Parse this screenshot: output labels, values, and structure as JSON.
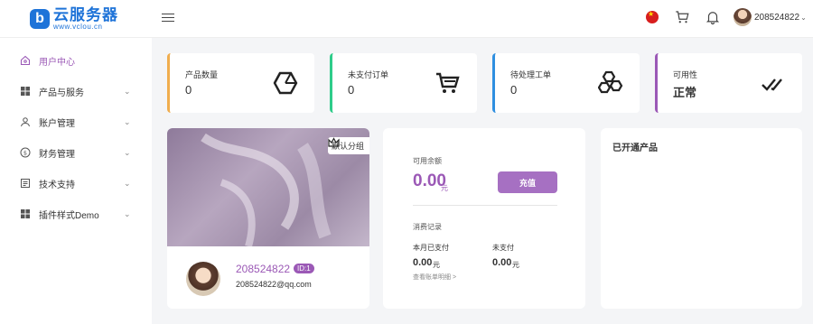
{
  "header": {
    "logo_badge": "b",
    "logo_title": "云服务器",
    "logo_url": "www.vclou.cn",
    "username": "208524822",
    "caret": "⌄"
  },
  "sidebar": {
    "items": [
      {
        "label": "用户中心",
        "icon": "home-icon",
        "active": true
      },
      {
        "label": "产品与服务",
        "icon": "grid-icon",
        "chevron": "⌄"
      },
      {
        "label": "账户管理",
        "icon": "user-icon",
        "chevron": "⌄"
      },
      {
        "label": "财务管理",
        "icon": "dollar-icon",
        "chevron": "⌄"
      },
      {
        "label": "技术支持",
        "icon": "ticket-icon",
        "chevron": "⌄"
      },
      {
        "label": "插件样式Demo",
        "icon": "grid-icon",
        "chevron": "⌄"
      }
    ]
  },
  "stats": [
    {
      "label": "产品数量",
      "value": "0",
      "color": "#f0ad4e",
      "icon": "hexagon-icon"
    },
    {
      "label": "未支付订单",
      "value": "0",
      "color": "#2ecc8a",
      "icon": "cart-icon"
    },
    {
      "label": "待处理工单",
      "value": "0",
      "color": "#2f8fe0",
      "icon": "hexagons-icon"
    },
    {
      "label": "可用性",
      "value": "正常",
      "color": "#9b59b6",
      "icon": "double-check-icon"
    }
  ],
  "profile": {
    "group_tag": "默认分组",
    "name": "208524822",
    "id_badge": "ID:1",
    "email": "208524822@qq.com"
  },
  "balance": {
    "label": "可用余额",
    "amount": "0.00",
    "unit": "元",
    "recharge_button": "充值",
    "records_title": "消费记录",
    "paid_label": "本月已支付",
    "paid_value": "0.00",
    "paid_unit": "元",
    "unpaid_label": "未支付",
    "unpaid_value": "0.00",
    "unpaid_unit": "元",
    "bill_link": "查看账单明细 >"
  },
  "products": {
    "title": "已开通产品"
  },
  "colors": {
    "accent": "#9b59b6",
    "brand": "#1e73d8"
  }
}
